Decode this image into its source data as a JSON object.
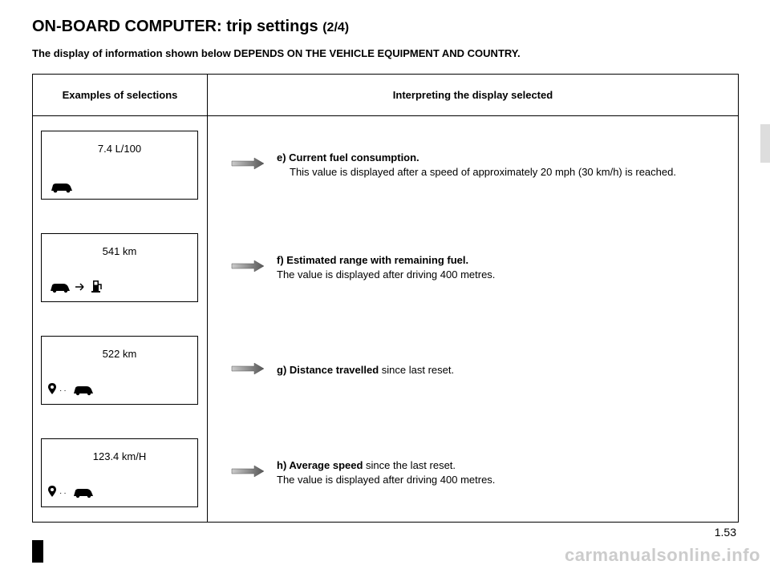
{
  "title_main": "ON-BOARD COMPUTER: trip settings ",
  "title_sub": "(2/4)",
  "notice": "The display of information shown below DEPENDS ON THE VEHICLE EQUIPMENT AND COUNTRY.",
  "header_left": "Examples of selections",
  "header_right": "Interpreting the display selected",
  "rows": [
    {
      "value": "7.4 L/100",
      "icon": "car",
      "letter": "e) ",
      "bold": "Current fuel consumption.",
      "rest": "This value is displayed after a speed of approximately 20 mph (30 km/h) is reached."
    },
    {
      "value": "541 km",
      "icon": "car-to-pump",
      "letter": "f)  ",
      "bold": "Estimated range with remaining fuel.",
      "rest": "The value is displayed after driving 400 metres."
    },
    {
      "value": "522 km",
      "icon": "pin-dots-car",
      "letter": "g) ",
      "bold": "Distance travelled",
      "rest": " since last reset."
    },
    {
      "value": "123.4 km/H",
      "icon": "pin-dots-car",
      "letter": "h) ",
      "bold": "Average speed",
      "rest": " since the last reset.\nThe value is displayed after driving 400 metres."
    }
  ],
  "page_num": "1.53",
  "watermark": "carmanualsonline.info"
}
